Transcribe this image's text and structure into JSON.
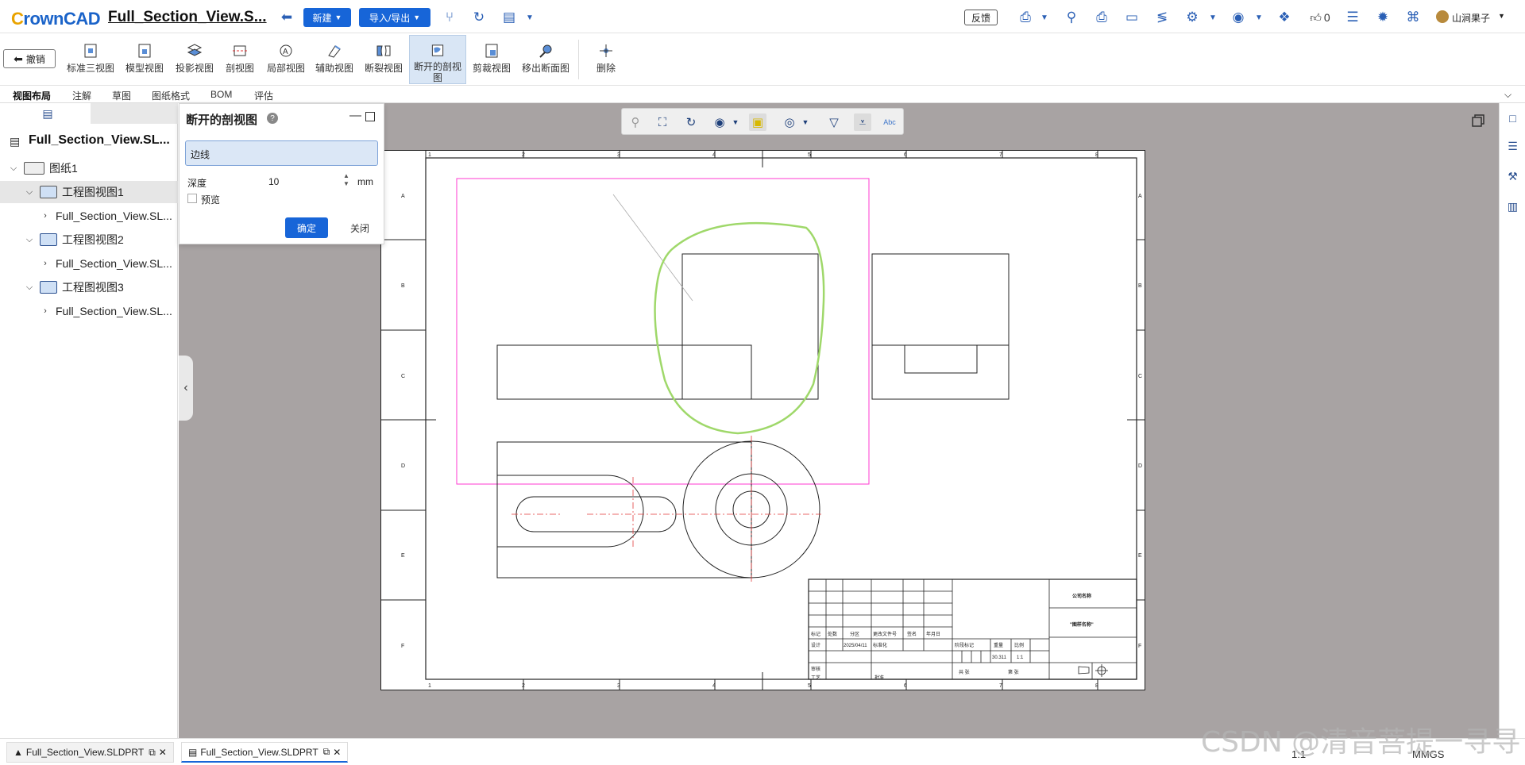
{
  "app": {
    "logo_prefix": "C",
    "logo_rest": "rownCAD",
    "doc_title": "Full_Section_View.S..."
  },
  "topbar": {
    "new_label": "新建",
    "import_export_label": "导入/导出",
    "feedback_label": "反馈",
    "like_count": "0",
    "user_name": "山涧果子"
  },
  "ribbon": {
    "undo_label": "撤销",
    "buttons": [
      {
        "label": "标准三视图"
      },
      {
        "label": "模型视图"
      },
      {
        "label": "投影视图"
      },
      {
        "label": "剖视图"
      },
      {
        "label": "局部视图"
      },
      {
        "label": "辅助视图"
      },
      {
        "label": "断裂视图"
      },
      {
        "label": "断开的剖视图",
        "active": true
      },
      {
        "label": "剪裁视图"
      },
      {
        "label": "移出断面图"
      },
      {
        "label": "删除"
      }
    ]
  },
  "tabs": [
    "视图布局",
    "注解",
    "草图",
    "图纸格式",
    "BOM",
    "评估"
  ],
  "tree": {
    "root": "Full_Section_View.SL...",
    "sheet": "图纸1",
    "views": [
      {
        "label": "工程图视图1",
        "child": "Full_Section_View.SL..."
      },
      {
        "label": "工程图视图2",
        "child": "Full_Section_View.SL..."
      },
      {
        "label": "工程图视图3",
        "child": "Full_Section_View.SL..."
      }
    ]
  },
  "dialog": {
    "title": "断开的剖视图",
    "help": "?",
    "edge_field": "边线",
    "depth_label": "深度",
    "depth_value": "10",
    "depth_unit": "mm",
    "preview_label": "预览",
    "ok_label": "确定",
    "close_label": "关闭"
  },
  "sheet": {
    "col_labels": [
      "1",
      "2",
      "3",
      "4",
      "5",
      "6",
      "7",
      "8"
    ],
    "row_labels": [
      "A",
      "B",
      "C",
      "D",
      "E",
      "F"
    ],
    "title_block": {
      "company": "公司名称",
      "drawing_name": "\"图样名称\"",
      "row_headers": [
        "标记",
        "处数",
        "分区",
        "更改文件号",
        "签名",
        "年月日"
      ],
      "left_labels": [
        "设计",
        "审核",
        "工艺"
      ],
      "date": "2025/04/11",
      "std": "标准化",
      "batch": "批准",
      "stage": "阶段标记",
      "weight": "重量",
      "ratio": "比例",
      "weight_value": "30.311",
      "ratio_value": "1:1",
      "sheets_total": "共 张",
      "sheet_no": "第 张"
    }
  },
  "bottombar": {
    "doc_tabs": [
      "Full_Section_View.SLDPRT",
      "Full_Section_View.SLDPRT"
    ],
    "scale": "1:1",
    "units": "MMGS"
  },
  "watermark": "CSDN @清音菩提一寻寻",
  "colors": {
    "accent": "#1765d8",
    "canvas_bg": "#a8a3a3",
    "spline": "#9fd86a",
    "boundary": "#ff3ad0",
    "centerline": "#e23a3a"
  }
}
